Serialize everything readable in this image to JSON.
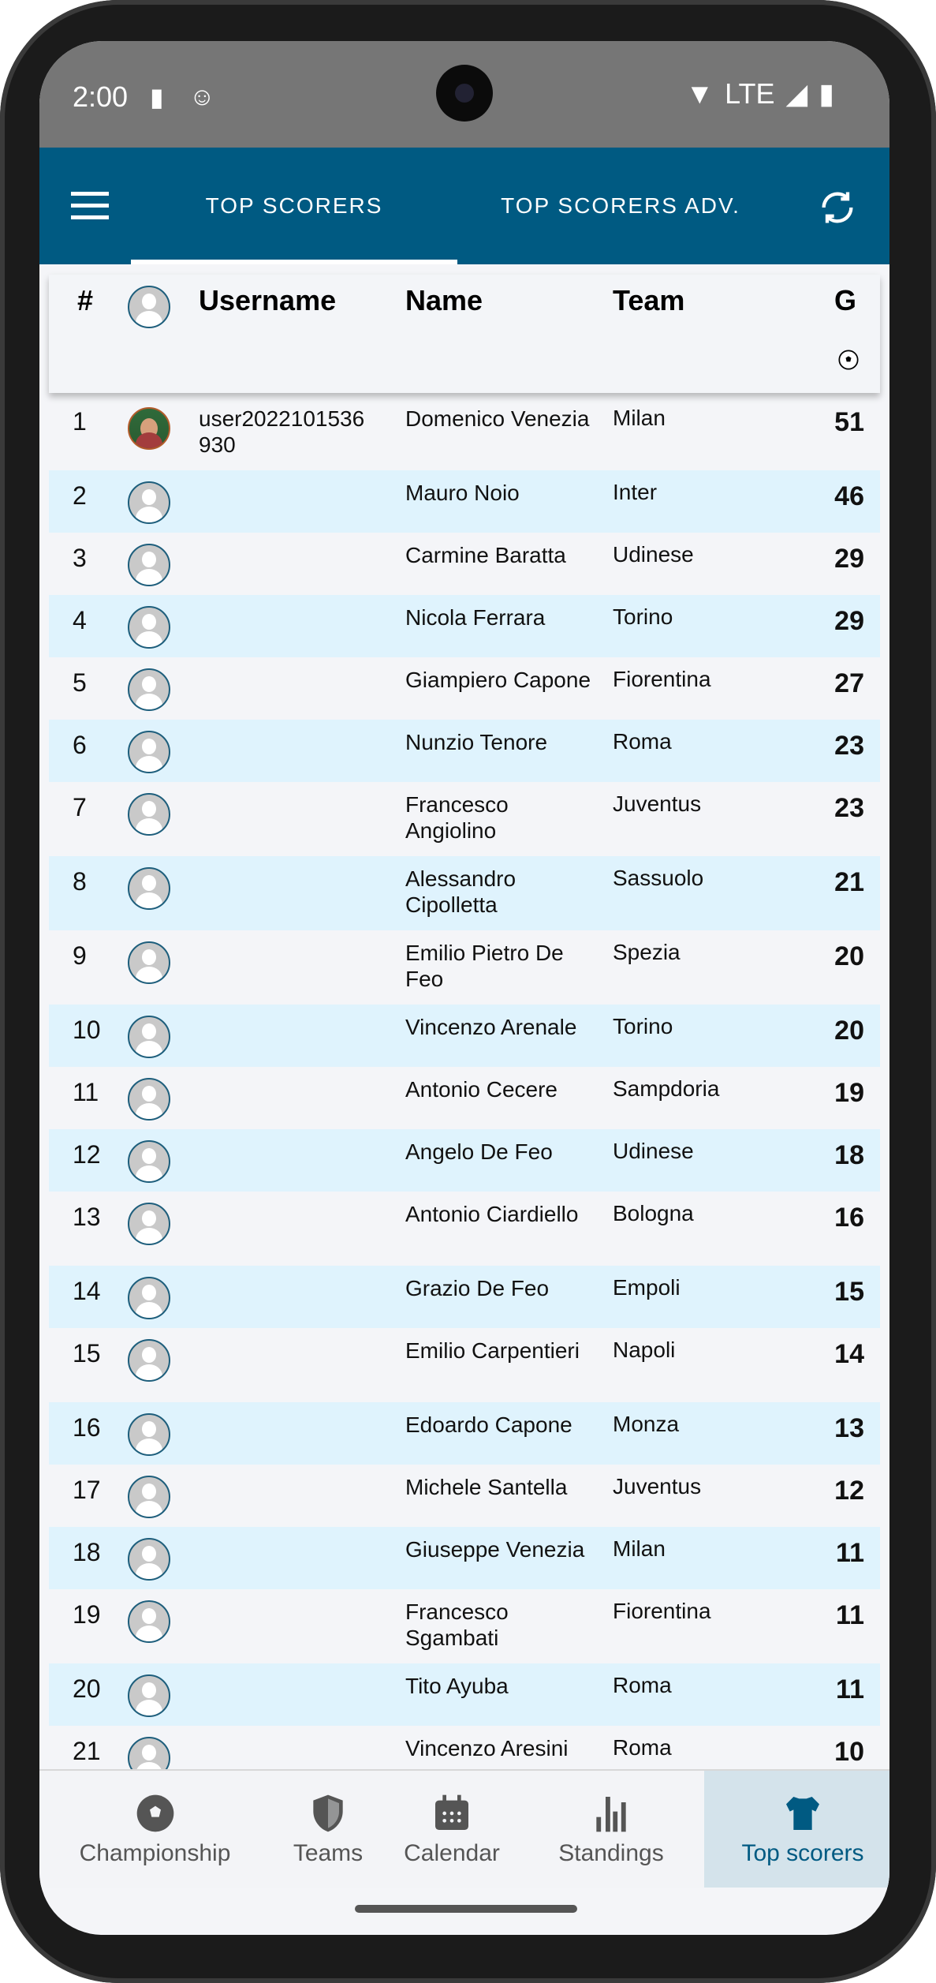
{
  "status_bar": {
    "time": "2:00",
    "network": "LTE"
  },
  "app_bar": {
    "tabs": [
      {
        "label": "TOP SCORERS",
        "active": true
      },
      {
        "label": "TOP SCORERS ADV.",
        "active": false
      }
    ]
  },
  "table": {
    "headers": {
      "rank": "#",
      "username": "Username",
      "name": "Name",
      "team": "Team",
      "goals": "G"
    },
    "rows": [
      {
        "rank": "1",
        "username": "user2022101536 930",
        "name": "Domenico Venezia",
        "team": "Milan",
        "goals": "51",
        "has_photo": true
      },
      {
        "rank": "2",
        "username": "",
        "name": "Mauro Noio",
        "team": "Inter",
        "goals": "46"
      },
      {
        "rank": "3",
        "username": "",
        "name": "Carmine Baratta",
        "team": "Udinese",
        "goals": "29"
      },
      {
        "rank": "4",
        "username": "",
        "name": "Nicola Ferrara",
        "team": "Torino",
        "goals": "29"
      },
      {
        "rank": "5",
        "username": "",
        "name": "Giampiero Capone",
        "team": "Fiorentina",
        "goals": "27"
      },
      {
        "rank": "6",
        "username": "",
        "name": "Nunzio Tenore",
        "team": "Roma",
        "goals": "23"
      },
      {
        "rank": "7",
        "username": "",
        "name": "Francesco Angiolino",
        "team": "Juventus",
        "goals": "23"
      },
      {
        "rank": "8",
        "username": "",
        "name": "Alessandro Cipolletta",
        "team": "Sassuolo",
        "goals": "21"
      },
      {
        "rank": "9",
        "username": "",
        "name": "Emilio Pietro De Feo",
        "team": "Spezia",
        "goals": "20"
      },
      {
        "rank": "10",
        "username": "",
        "name": "Vincenzo Arenale",
        "team": "Torino",
        "goals": "20"
      },
      {
        "rank": "11",
        "username": "",
        "name": "Antonio Cecere",
        "team": "Sampdoria",
        "goals": "19"
      },
      {
        "rank": "12",
        "username": "",
        "name": "Angelo De Feo",
        "team": "Udinese",
        "goals": "18"
      },
      {
        "rank": "13",
        "username": "",
        "name": "Antonio Ciardiello",
        "team": "Bologna",
        "goals": "16"
      },
      {
        "rank": "14",
        "username": "",
        "name": "Grazio De Feo",
        "team": "Empoli",
        "goals": "15"
      },
      {
        "rank": "15",
        "username": "",
        "name": "Emilio Carpentieri",
        "team": "Napoli",
        "goals": "14"
      },
      {
        "rank": "16",
        "username": "",
        "name": "Edoardo Capone",
        "team": "Monza",
        "goals": "13"
      },
      {
        "rank": "17",
        "username": "",
        "name": "Michele Santella",
        "team": "Juventus",
        "goals": "12"
      },
      {
        "rank": "18",
        "username": "",
        "name": "Giuseppe Venezia",
        "team": "Milan",
        "goals": "11"
      },
      {
        "rank": "19",
        "username": "",
        "name": "Francesco Sgambati",
        "team": "Fiorentina",
        "goals": "11"
      },
      {
        "rank": "20",
        "username": "",
        "name": "Tito Ayuba",
        "team": "Roma",
        "goals": "11"
      },
      {
        "rank": "21",
        "username": "",
        "name": "Vincenzo Aresini",
        "team": "Roma",
        "goals": "10"
      }
    ]
  },
  "bottom_nav": {
    "items": [
      {
        "label": "Championship",
        "icon": "soccer-ball-icon",
        "active": false
      },
      {
        "label": "Teams",
        "icon": "shield-icon",
        "active": false
      },
      {
        "label": "Calendar",
        "icon": "calendar-icon",
        "active": false
      },
      {
        "label": "Standings",
        "icon": "bar-chart-icon",
        "active": false
      },
      {
        "label": "Top scorers",
        "icon": "jersey-icon",
        "active": true
      }
    ]
  },
  "colors": {
    "primary": "#005a82",
    "row_alt": "#dff3fd",
    "row": "#f4f5f8",
    "nav_active_bg": "#d4e3eb"
  }
}
